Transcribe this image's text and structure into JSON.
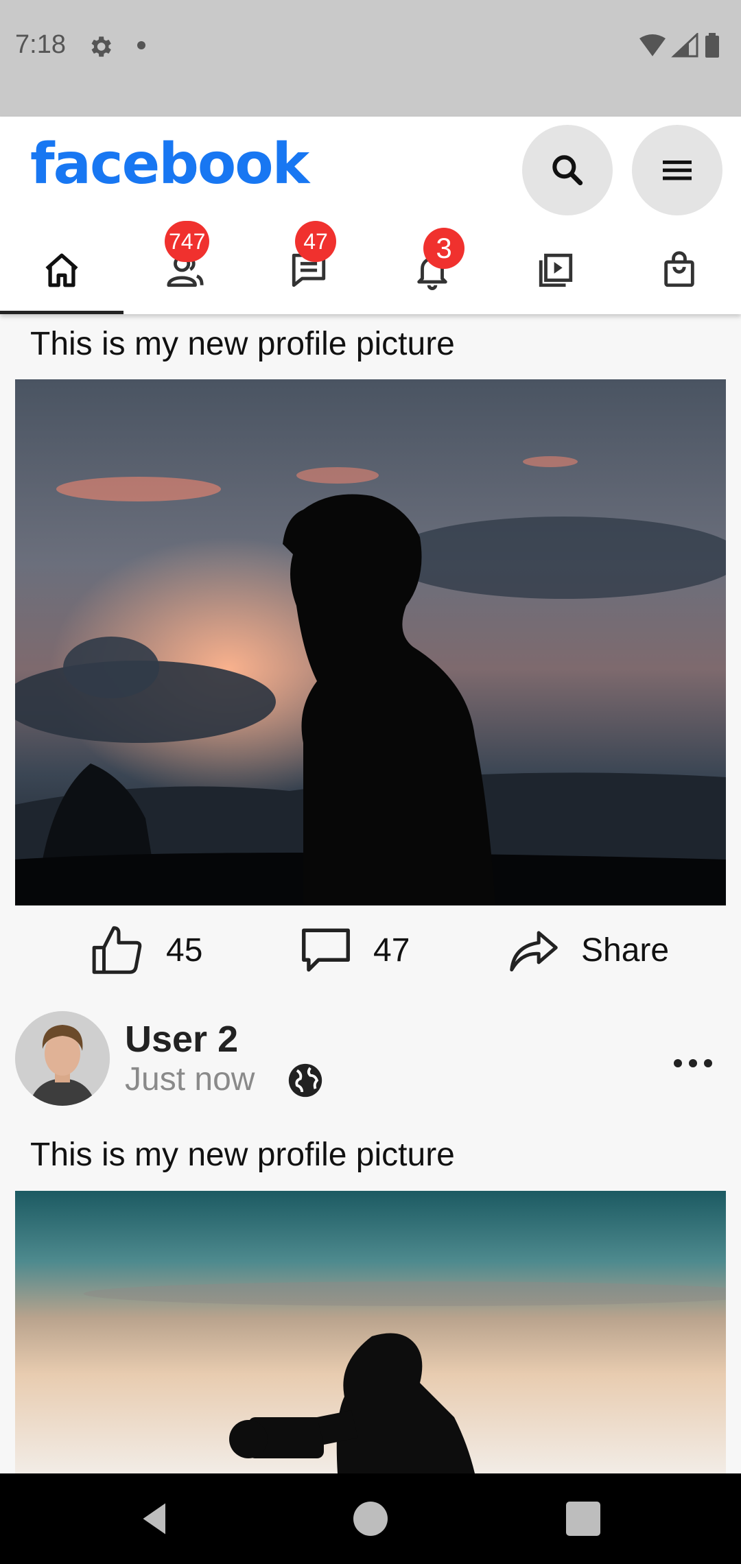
{
  "status_bar": {
    "time": "7:18",
    "icons": [
      "gear-icon",
      "dot-icon",
      "wifi-icon",
      "signal-icon",
      "battery-icon"
    ]
  },
  "header": {
    "logo_text": "facebook",
    "brand_color": "#1877f2",
    "buttons": [
      "search-icon",
      "menu-icon"
    ]
  },
  "tabs": [
    {
      "name": "home",
      "icon": "home-icon",
      "badge": "",
      "active": true
    },
    {
      "name": "friends",
      "icon": "friends-icon",
      "badge": "747"
    },
    {
      "name": "messages",
      "icon": "messages-icon",
      "badge": "47"
    },
    {
      "name": "notifications",
      "icon": "bell-icon",
      "badge": "3"
    },
    {
      "name": "watch",
      "icon": "video-icon",
      "badge": ""
    },
    {
      "name": "marketplace",
      "icon": "bag-icon",
      "badge": ""
    }
  ],
  "badge_color": "#f0312e",
  "posts": [
    {
      "caption": "This is my new profile picture",
      "likes": "45",
      "comments": "47",
      "share_label": "Share"
    },
    {
      "author": "User 2",
      "time": "Just now",
      "caption": "This is my new profile picture"
    }
  ],
  "nav_bar": [
    "back-icon",
    "home-circle-icon",
    "recents-icon"
  ]
}
